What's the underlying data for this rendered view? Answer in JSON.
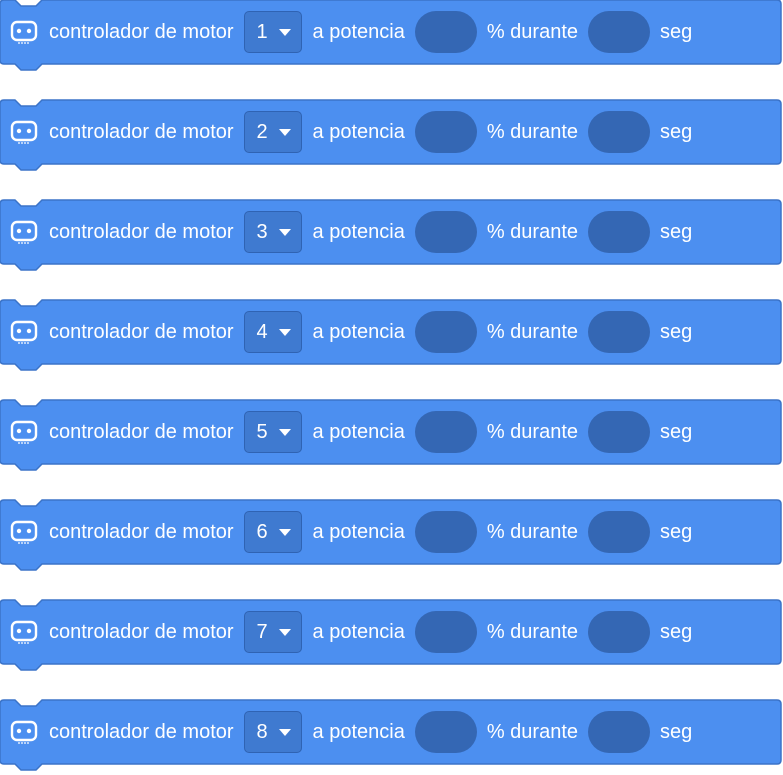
{
  "colors": {
    "block_fill": "#4c8ff0",
    "block_stroke": "#3b73c8",
    "input_fill": "#3467b4",
    "dropdown_fill": "#3f7ad0",
    "text": "#ffffff"
  },
  "blocks": [
    {
      "label": "controlador de motor",
      "motor": "1",
      "power_label": "a potencia",
      "during_label": "% durante",
      "unit_label": "seg",
      "icon": "microbit-icon"
    },
    {
      "label": "controlador de motor",
      "motor": "2",
      "power_label": "a potencia",
      "during_label": "% durante",
      "unit_label": "seg",
      "icon": "microbit-icon"
    },
    {
      "label": "controlador de motor",
      "motor": "3",
      "power_label": "a potencia",
      "during_label": "% durante",
      "unit_label": "seg",
      "icon": "microbit-icon"
    },
    {
      "label": "controlador de motor",
      "motor": "4",
      "power_label": "a potencia",
      "during_label": "% durante",
      "unit_label": "seg",
      "icon": "microbit-icon"
    },
    {
      "label": "controlador de motor",
      "motor": "5",
      "power_label": "a potencia",
      "during_label": "% durante",
      "unit_label": "seg",
      "icon": "microbit-icon"
    },
    {
      "label": "controlador de motor",
      "motor": "6",
      "power_label": "a potencia",
      "during_label": "% durante",
      "unit_label": "seg",
      "icon": "microbit-icon"
    },
    {
      "label": "controlador de motor",
      "motor": "7",
      "power_label": "a potencia",
      "during_label": "% durante",
      "unit_label": "seg",
      "icon": "microbit-icon"
    },
    {
      "label": "controlador de motor",
      "motor": "8",
      "power_label": "a potencia",
      "during_label": "% durante",
      "unit_label": "seg",
      "icon": "microbit-icon"
    }
  ]
}
